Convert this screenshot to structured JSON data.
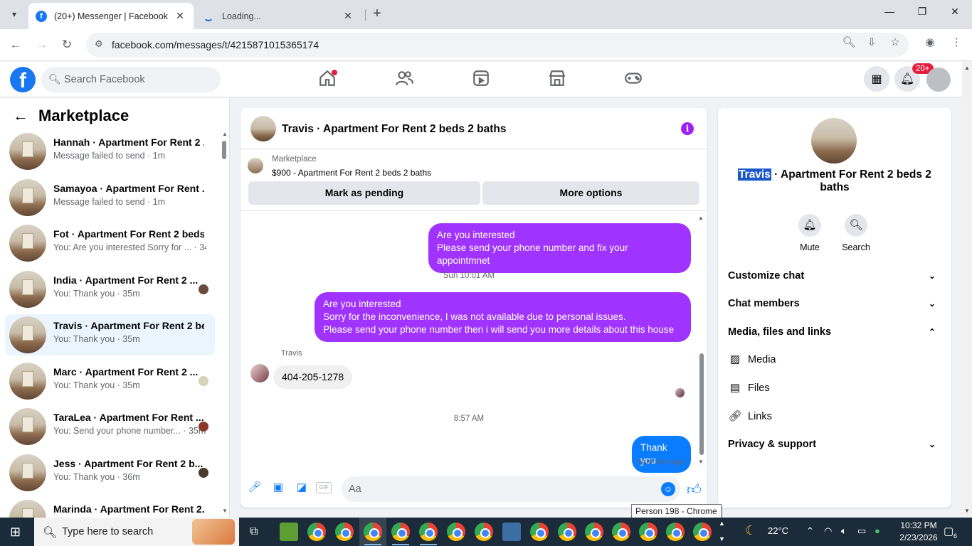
{
  "browser": {
    "tabs": [
      {
        "title": "(20+) Messenger | Facebook",
        "favicon": "f"
      },
      {
        "title": "Loading..."
      }
    ],
    "new_tab": "+",
    "url": "facebook.com/messages/t/4215871015365174"
  },
  "fb": {
    "logo": "f",
    "search_placeholder": "Search Facebook",
    "notif_badge": "20+"
  },
  "sidebar": {
    "title": "Marketplace",
    "conversations": [
      {
        "name": "Hannah · Apartment For Rent 2 ...",
        "sub": "Message failed to send · 1m",
        "mini": false
      },
      {
        "name": "Samayoa · Apartment For Rent ...",
        "sub": "Message failed to send · 1m",
        "mini": false
      },
      {
        "name": "Fot · Apartment For Rent 2 beds...",
        "sub": "You: Are you interested Sorry for ... · 34m",
        "mini": false
      },
      {
        "name": "India · Apartment For Rent 2 ...",
        "sub": "You: Thank you · 35m",
        "mini": true
      },
      {
        "name": "Travis · Apartment For Rent 2 be...",
        "sub": "You: Thank you · 35m",
        "mini": false
      },
      {
        "name": "Marc · Apartment For Rent 2 ...",
        "sub": "You: Thank you · 35m",
        "mini": true
      },
      {
        "name": "TaraLea · Apartment For Rent ...",
        "sub": "You: Send your phone number... · 35m",
        "mini": true
      },
      {
        "name": "Jess · Apartment For Rent 2 b...",
        "sub": "You: Thank you · 36m",
        "mini": true
      },
      {
        "name": "Marinda · Apartment For Rent 2...",
        "sub": "",
        "mini": false
      }
    ]
  },
  "chat": {
    "header_name": "Travis · Apartment For Rent 2 beds 2 baths",
    "info_icon": "i",
    "marketplace_label": "Marketplace",
    "listing": "$900 - Apartment For Rent 2 beds 2 baths",
    "mark_pending": "Mark as pending",
    "more_options": "More options",
    "msg1_line1": "Are you interested",
    "msg1_line2": "Please send your phone number and fix your appointmnet",
    "time1": "Sun 10:01 AM",
    "msg2_line1": "Are you interested",
    "msg2_line2": "Sorry for the inconvenience, I was not available due to personal issues.",
    "msg2_line3": "Please send your phone number then i will send you more details about this house",
    "sender": "Travis",
    "received": "404-205-1278",
    "time2": "8:57 AM",
    "msg3": "Thank you",
    "sent_status": "Sent 35m ago",
    "composer_placeholder": "Aa",
    "gif_label": "GIF"
  },
  "rpanel": {
    "name_highlight": "Travis",
    "name_rest": " · Apartment For Rent 2 beds 2 baths",
    "mute": "Mute",
    "search": "Search",
    "customize": "Customize chat",
    "members": "Chat members",
    "media_files": "Media, files and links",
    "media": "Media",
    "files": "Files",
    "links": "Links",
    "privacy": "Privacy & support"
  },
  "tooltip": "Person 198 - Chrome",
  "taskbar": {
    "search_placeholder": "Type here to search",
    "weather": "22°C",
    "time": "10:32 PM",
    "date": "2/23/2026",
    "notif_count": "6"
  },
  "colors": {
    "fb_blue": "#1877f2",
    "bubble_purple": "#a033ff",
    "bubble_blue": "#0a7cff",
    "badge_red": "#e41e3f"
  }
}
